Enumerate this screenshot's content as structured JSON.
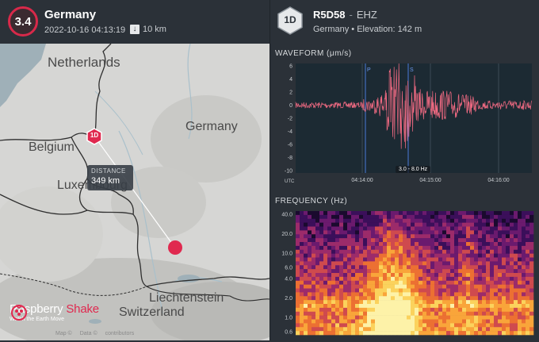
{
  "event": {
    "magnitude": "3.4",
    "region": "Germany",
    "datetime": "2022-10-16 04:13:19",
    "depth": "10 km",
    "depth_icon": "arrow-down-icon"
  },
  "map": {
    "labels": {
      "netherlands": "Netherlands",
      "belgium": "Belgium",
      "luxembourg": "Luxembourg",
      "germany": "Germany",
      "liechtenstein": "Liechtenstein",
      "switzerland": "Switzerland"
    },
    "station_marker": "1D",
    "distance": {
      "label": "DISTANCE",
      "value": "349 km"
    },
    "logo": {
      "name_part1": "Raspberry",
      "name_part2": "Shake",
      "tagline": "Watch the Earth Move"
    },
    "attribution": [
      "Map ©",
      "Data ©",
      "contributors"
    ]
  },
  "station": {
    "badge": "1D",
    "code": "R5D58",
    "separator": "-",
    "channel": "EHZ",
    "location": "Germany • Elevation: 142 m"
  },
  "waveform": {
    "title": "WAVEFORM (μm/s)",
    "y_ticks": [
      "6",
      "4",
      "2",
      "0",
      "-2",
      "-4",
      "-6",
      "-8",
      "-10"
    ],
    "x_ticks": [
      "04:14:00",
      "04:15:00",
      "04:16:00"
    ],
    "x_unit": "UTC",
    "phase_markers": [
      "P",
      "S"
    ],
    "band": "3.0 - 8.0 Hz",
    "line_color": "#f06a82"
  },
  "frequency": {
    "title": "FREQUENCY (Hz)",
    "y_ticks": [
      "40.0",
      "20.0",
      "10.0",
      "6.0",
      "4.0",
      "2.0",
      "1.0",
      "0.6"
    ]
  },
  "colors": {
    "accent": "#e0294f",
    "panel": "#2b3138",
    "plot_bg": "#1c2a33"
  }
}
